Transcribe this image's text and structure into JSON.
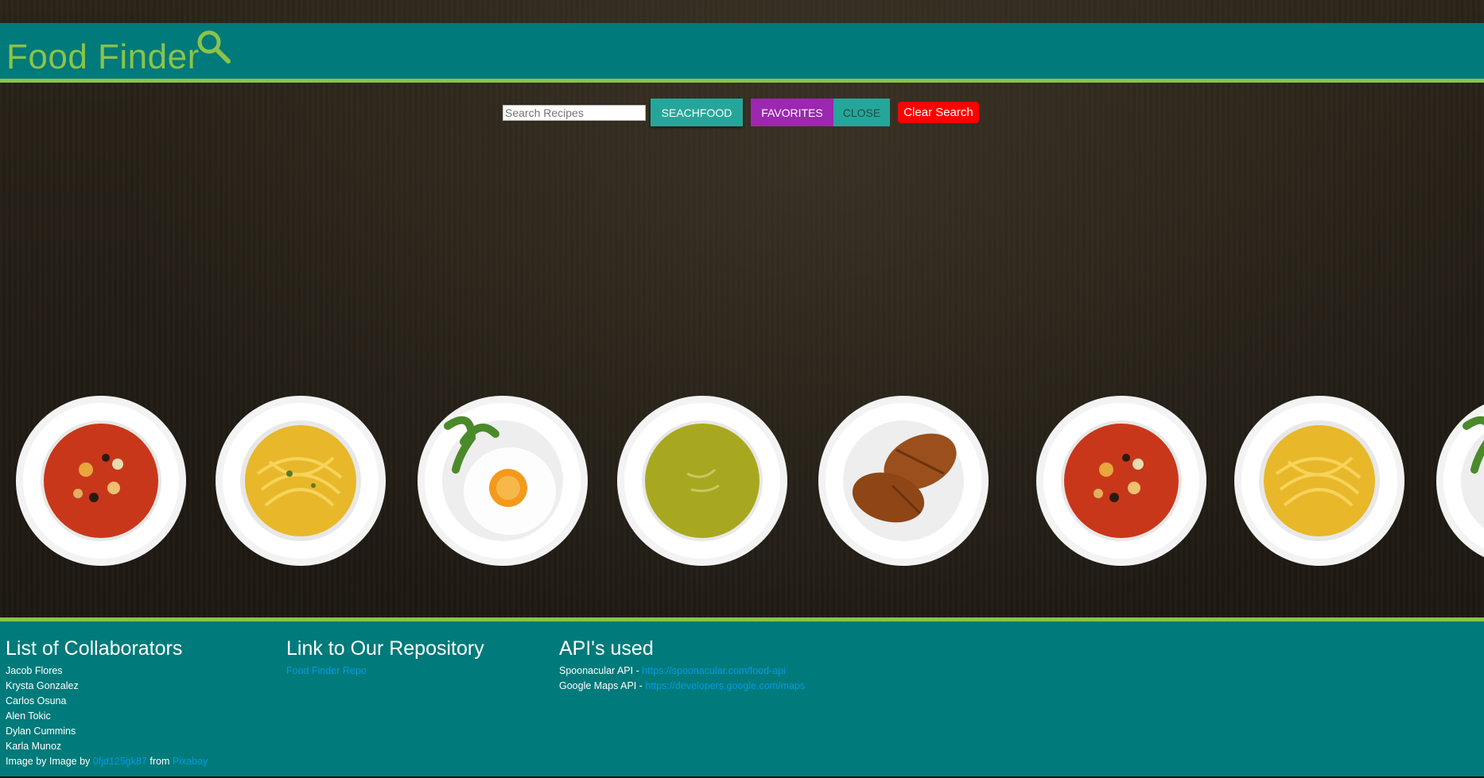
{
  "header": {
    "title": "Food Finder",
    "icon": "search-icon",
    "brand_color": "#8bc34a",
    "bar_color": "#007a7a"
  },
  "search": {
    "placeholder": "Search Recipes",
    "search_label": "SEACHFOOD",
    "favorites_label": "FAVORITES",
    "close_label": "CLOSE",
    "clear_label": "Clear Search"
  },
  "plates": [
    {
      "dish": "soup-red"
    },
    {
      "dish": "spaghetti"
    },
    {
      "dish": "fried-egg"
    },
    {
      "dish": "pea-soup"
    },
    {
      "dish": "croissants"
    },
    {
      "dish": "soup-red"
    },
    {
      "dish": "spaghetti"
    },
    {
      "dish": "fried-egg"
    }
  ],
  "footer": {
    "collaborators": {
      "heading": "List of Collaborators",
      "names": [
        "Jacob Flores",
        "Krysta Gonzalez",
        "Carlos Osuna",
        "Alen Tokic",
        "Dylan Cummins",
        "Karla Munoz"
      ],
      "credit_prefix": "Image by Image by",
      "credit_author": "0fjd125gk87",
      "credit_middle": "from",
      "credit_site": "Pixabay"
    },
    "repo": {
      "heading": "Link to Our Repository",
      "link": "Food Finder Repo"
    },
    "apis": {
      "heading": "API's used",
      "items": [
        {
          "label": "Spoonacular API - ",
          "url": "https://spoonacular.com/food-api"
        },
        {
          "label": "Google Maps API - ",
          "url": "https://developers.google.com/maps"
        }
      ]
    }
  }
}
